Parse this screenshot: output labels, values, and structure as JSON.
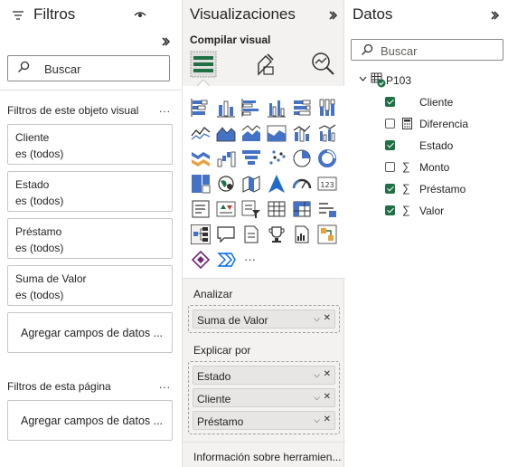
{
  "filters": {
    "title": "Filtros",
    "search_placeholder": "Buscar",
    "visual_section": "Filtros de este objeto visual",
    "visual_section_more": "...",
    "cards": [
      {
        "name": "Cliente",
        "value": "es (todos)"
      },
      {
        "name": "Estado",
        "value": "es (todos)"
      },
      {
        "name": "Préstamo",
        "value": "es (todos)"
      },
      {
        "name": "Suma de Valor",
        "value": "es (todos)"
      }
    ],
    "add_fields_visual": "Agregar campos de datos ...",
    "page_section": "Filtros de esta página",
    "page_section_more": "...",
    "add_fields_page": "Agregar campos de datos ..."
  },
  "viz": {
    "title": "Visualizaciones",
    "build_label": "Compilar visual",
    "more_visuals": "···",
    "analyze_label": "Analizar",
    "analyze_chips": [
      "Suma de Valor"
    ],
    "explain_label": "Explicar por",
    "explain_chips": [
      "Estado",
      "Cliente",
      "Préstamo"
    ],
    "tooltips_label": "Información sobre herramien..."
  },
  "datos": {
    "title": "Datos",
    "search_placeholder": "Buscar",
    "table_name": "P103",
    "fields": [
      {
        "label": "Cliente",
        "checked": true,
        "icon": "none"
      },
      {
        "label": "Diferencia",
        "checked": false,
        "icon": "calculator-icon"
      },
      {
        "label": "Estado",
        "checked": true,
        "icon": "none"
      },
      {
        "label": "Monto",
        "checked": false,
        "icon": "sigma-icon"
      },
      {
        "label": "Préstamo",
        "checked": true,
        "icon": "sigma-icon"
      },
      {
        "label": "Valor",
        "checked": true,
        "icon": "sigma-icon"
      }
    ]
  },
  "colors": {
    "accent_green": "#1e7145",
    "pane_gray": "#f3f2f1",
    "border": "#c8c6c4"
  }
}
